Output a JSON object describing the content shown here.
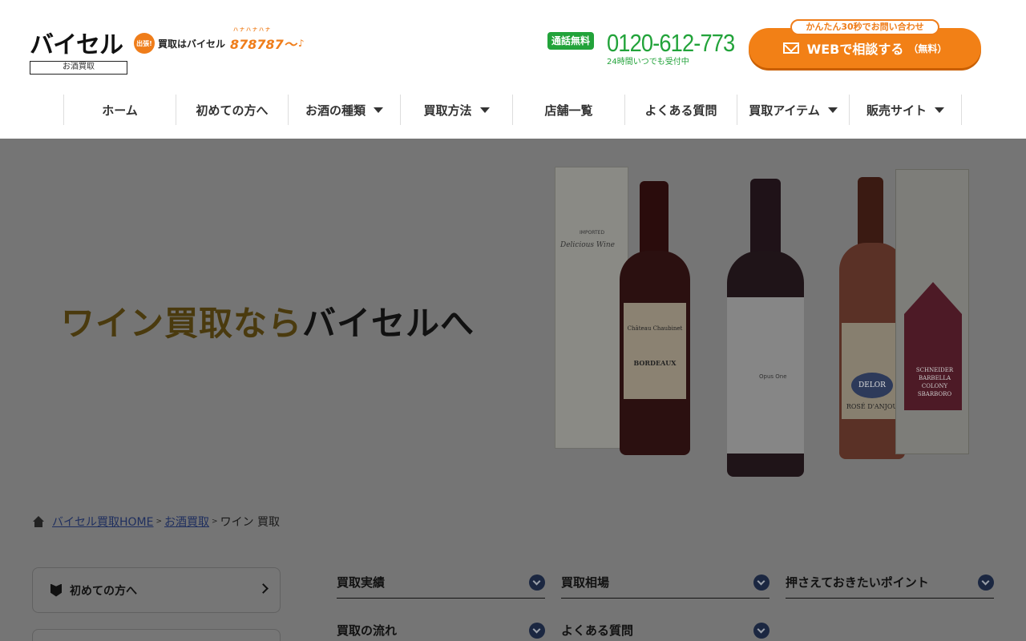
{
  "header": {
    "logo_text": "バイセル",
    "logo_sub": "お酒買取",
    "tag_badge": "出張!",
    "tag_text": "買取はバイセル",
    "tag_number": "878787〜",
    "tag_ruby": "ハナハナハナ",
    "phone_badge": "通話無料",
    "phone_number": "0120-612-773",
    "phone_hours": "24時間いつでも受付中",
    "web_tip": "かんたん30秒でお問い合わせ",
    "web_button": "WEBで相談する",
    "web_button_small": "（無料）"
  },
  "nav": [
    {
      "label": "ホーム",
      "dropdown": false
    },
    {
      "label": "初めての方へ",
      "dropdown": false
    },
    {
      "label": "お酒の種類",
      "dropdown": true
    },
    {
      "label": "買取方法",
      "dropdown": true
    },
    {
      "label": "店舗一覧",
      "dropdown": false
    },
    {
      "label": "よくある質問",
      "dropdown": false
    },
    {
      "label": "買取アイテム",
      "dropdown": true
    },
    {
      "label": "販売サイト",
      "dropdown": true
    }
  ],
  "hero": {
    "title_gold": "ワイン買取なら",
    "title_black": "バイセルへ",
    "box1_label": "Delicious Wine",
    "box1_imported": "IMPORTED",
    "bottle1_label": "Château Chaubinet",
    "bottle1_label2": "BORDEAUX",
    "bottle2_label": "Opus One",
    "bottle3_oval": "DELOR",
    "bottle3_label": "ROSÉ D'ANJOU",
    "box2_text": "SCHNEIDER BARBELLA COLONY SBARBORO"
  },
  "breadcrumb": {
    "home": "バイセル買取HOME",
    "sep": ">",
    "parent": "お酒買取",
    "current": "ワイン 買取"
  },
  "sidebar": {
    "first_card": "初めての方へ"
  },
  "anchors": [
    {
      "label": "買取実績"
    },
    {
      "label": "買取相場"
    },
    {
      "label": "押さえておきたいポイント"
    },
    {
      "label": "買取の流れ"
    },
    {
      "label": "よくある質問"
    }
  ]
}
